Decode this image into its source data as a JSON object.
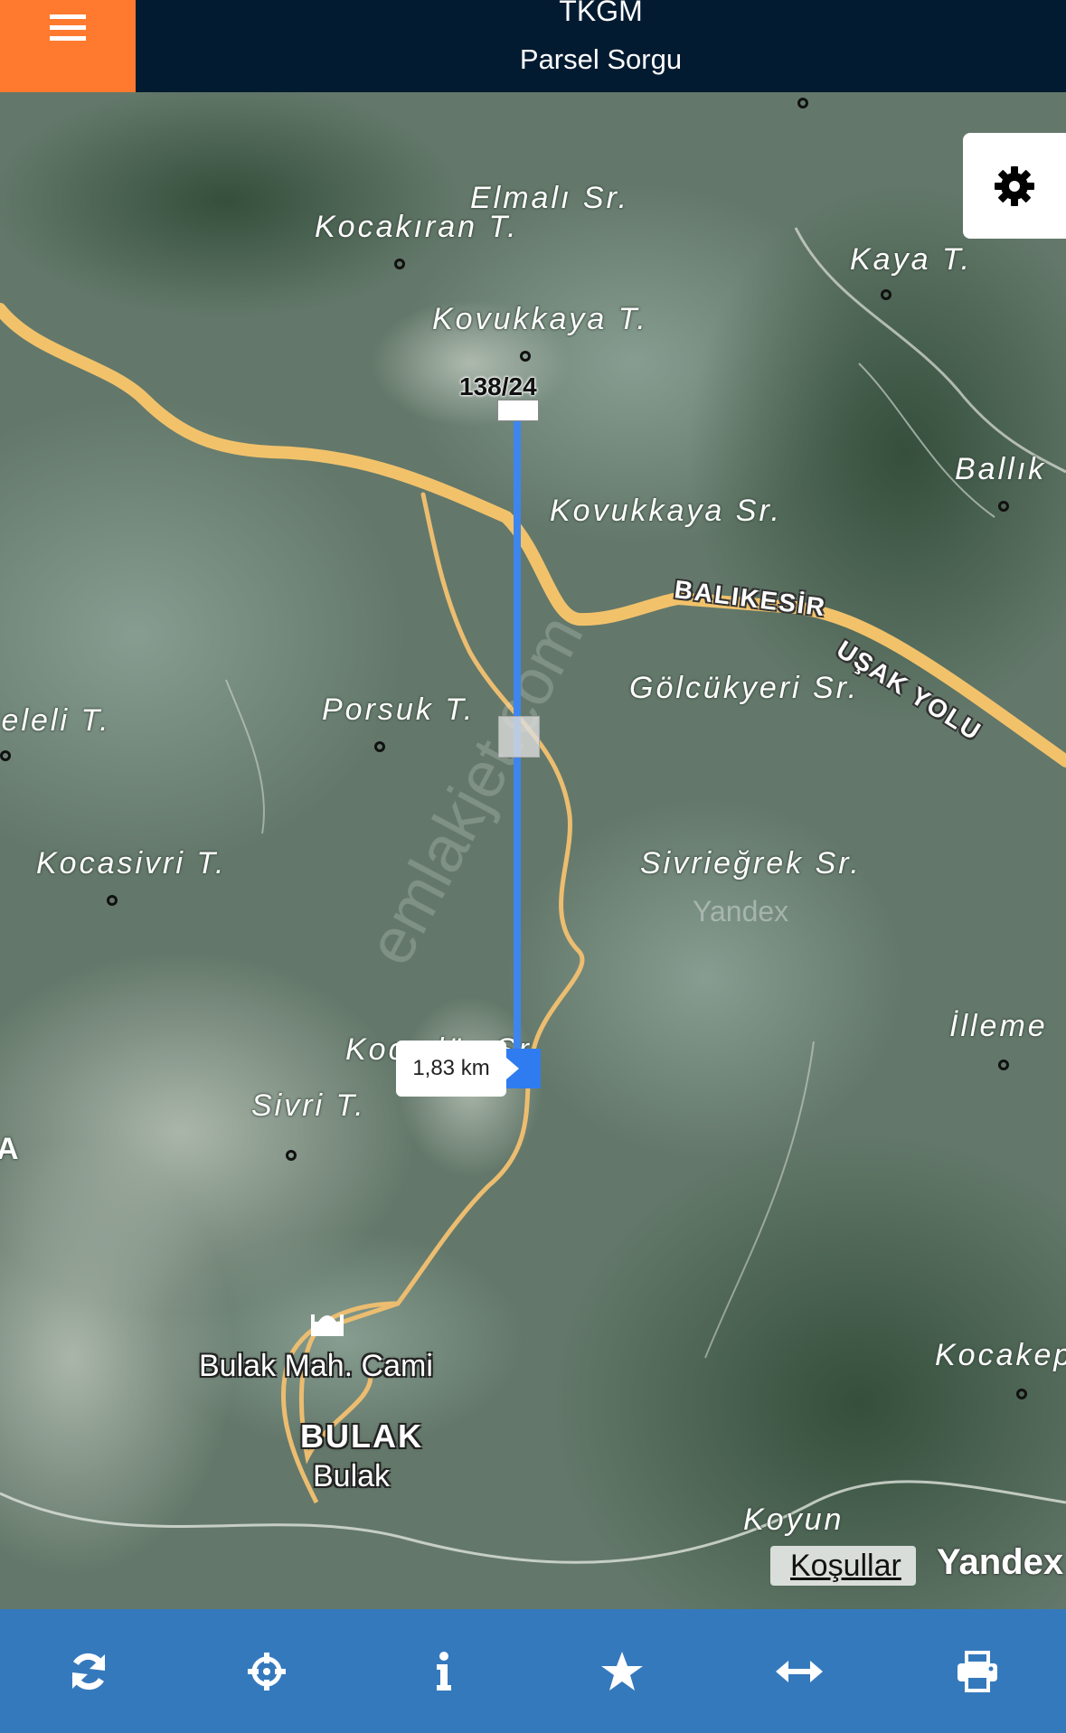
{
  "header": {
    "title": "TKGM",
    "subtitle": "Parsel Sorgu"
  },
  "map": {
    "parcel_label": "138/24",
    "distance": "1,83 km",
    "watermark": "emlakjet.com",
    "yandex_inmap": "Yandex",
    "terms_label": "Koşullar",
    "yandex_logo": "Yandex",
    "road_name_1": "BALIKESİR",
    "road_name_2": "UŞAK YOLU",
    "labels": {
      "elmali": "Elmalı Sr.",
      "kocakiran": "Kocakıran T.",
      "kovukkaya_t": "Kovukkaya T.",
      "kaya": "Kaya T.",
      "ballik": "Ballık",
      "kovukkaya_sr": "Kovukkaya Sr.",
      "golcukyeri": "Gölcükyeri Sr.",
      "porsuk": "Porsuk T.",
      "celeli": "Çeleli T.",
      "kocasivri": "Kocasivri T.",
      "sivriegrek": "Sivrieğrek Sr.",
      "illeme": "İlleme",
      "kocaduz": "Kocadüz Sr.",
      "sivri": "Sivri T.",
      "edge_a": "A",
      "kocakep": "Kocakep",
      "koyun": "Koyun",
      "mosque": "Bulak Mah. Cami",
      "village_upper": "BULAK",
      "village": "Bulak"
    }
  },
  "toolbar": {
    "icons": [
      "refresh-icon",
      "locate-icon",
      "info-icon",
      "star-icon",
      "measure-icon",
      "print-icon"
    ]
  },
  "colors": {
    "header_bg": "#031b30",
    "menu_bg": "#ff7a2f",
    "toolbar_bg": "#3579bd",
    "measure_line": "#3d86ef",
    "road": "#f2c26b"
  }
}
